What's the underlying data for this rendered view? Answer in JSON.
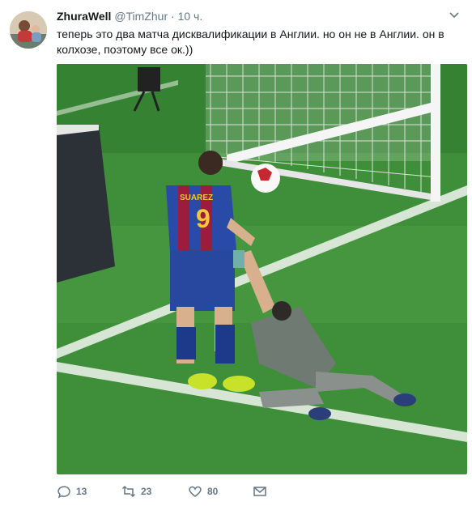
{
  "tweet": {
    "author_name": "ZhuraWell",
    "handle": "@TimZhur",
    "separator": "·",
    "time": "10 ч.",
    "text": "теперь это два матча дисквалификации в Англии. но он не в Англии. он в колхозе, поэтому все ок.))",
    "media": {
      "description_icon": "photo-soccer",
      "shirt_name": "SUAREZ",
      "shirt_number": "9"
    },
    "actions": {
      "replies": "13",
      "retweets": "23",
      "likes": "80"
    }
  },
  "colors": {
    "accent": "#1da1f2",
    "muted": "#657786",
    "pitch": "#3f8f3a"
  }
}
